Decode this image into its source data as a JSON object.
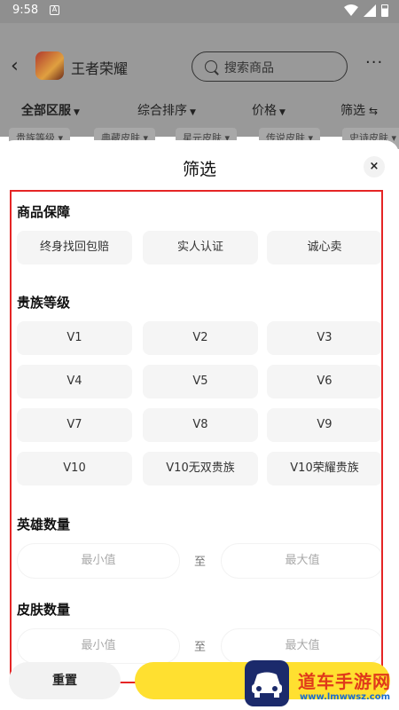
{
  "status_bar": {
    "time": "9:58",
    "notification_badge": "A"
  },
  "header": {
    "title": "王者荣耀",
    "search_placeholder": "搜索商品",
    "more": "···"
  },
  "sort_bar": {
    "items": [
      "全部区服",
      "综合排序",
      "价格",
      "筛选"
    ]
  },
  "chips": [
    "贵族等级",
    "典藏皮肤",
    "星元皮肤",
    "传说皮肤",
    "史诗皮肤"
  ],
  "sheet": {
    "title": "筛选",
    "close": "×",
    "sections": {
      "guarantee": {
        "title": "商品保障",
        "options": [
          "终身找回包赔",
          "实人认证",
          "诚心卖"
        ]
      },
      "noble_level": {
        "title": "贵族等级",
        "options": [
          "V1",
          "V2",
          "V3",
          "V4",
          "V5",
          "V6",
          "V7",
          "V8",
          "V9",
          "V10",
          "V10无双贵族",
          "V10荣耀贵族"
        ]
      },
      "hero_count": {
        "title": "英雄数量",
        "min_placeholder": "最小值",
        "separator": "至",
        "max_placeholder": "最大值"
      },
      "skin_count": {
        "title": "皮肤数量",
        "min_placeholder": "最小值",
        "separator": "至",
        "max_placeholder": "最大值"
      }
    },
    "reset_label": "重置"
  },
  "watermark": {
    "name": "道车手游网",
    "url": "www.lmwwsz.com"
  },
  "colors": {
    "highlight_border": "#e52525",
    "confirm": "#ffe030",
    "watermark_red": "#e03a1a"
  }
}
